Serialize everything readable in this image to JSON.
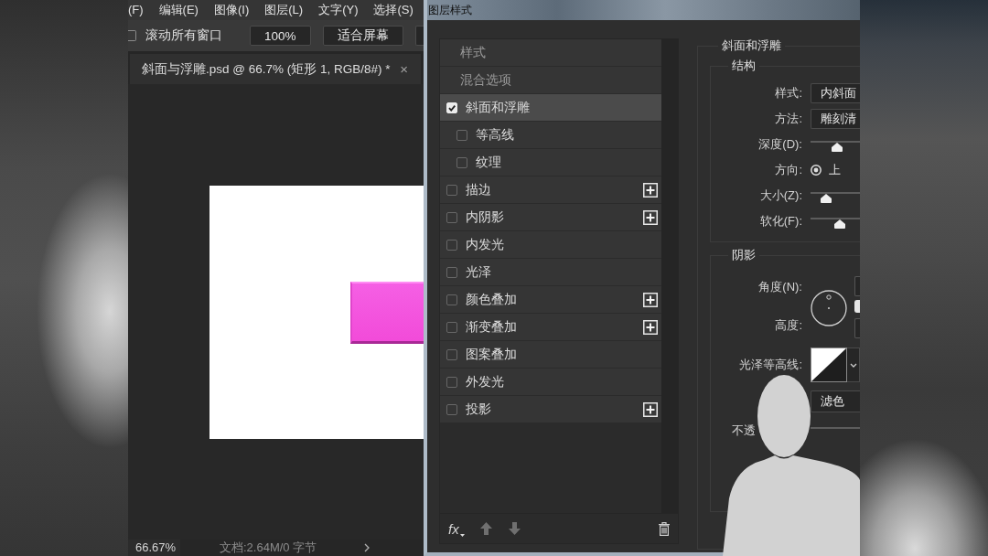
{
  "workspace": {
    "menu_bar": [
      "(F)",
      "编辑(E)",
      "图像(I)",
      "图层(L)",
      "文字(Y)",
      "选择(S)"
    ],
    "options_bar": {
      "scroll_all_windows": {
        "label": "滚动所有窗口",
        "checked": false
      },
      "buttons": [
        "100%",
        "适合屏幕"
      ]
    },
    "document_tab": {
      "title": "斜面与浮雕.psd @ 66.7% (矩形 1, RGB/8#) *",
      "close": "×"
    },
    "status_bar": {
      "zoom": "66.67%",
      "document_info": "文档:2.64M/0 字节"
    }
  },
  "dialog": {
    "title": "图层样式",
    "style_list": [
      {
        "kind": "header",
        "label": "样式",
        "selected": false
      },
      {
        "kind": "header",
        "label": "混合选项",
        "selected": false
      },
      {
        "kind": "effect",
        "label": "斜面和浮雕",
        "checked": true,
        "selected": true,
        "addable": false,
        "children": [
          {
            "kind": "effect",
            "label": "等高线",
            "checked": false,
            "selected": false,
            "addable": false
          },
          {
            "kind": "effect",
            "label": "纹理",
            "checked": false,
            "selected": false,
            "addable": false
          }
        ]
      },
      {
        "kind": "effect",
        "label": "描边",
        "checked": false,
        "selected": false,
        "addable": true
      },
      {
        "kind": "effect",
        "label": "内阴影",
        "checked": false,
        "selected": false,
        "addable": true
      },
      {
        "kind": "effect",
        "label": "内发光",
        "checked": false,
        "selected": false,
        "addable": false
      },
      {
        "kind": "effect",
        "label": "光泽",
        "checked": false,
        "selected": false,
        "addable": false
      },
      {
        "kind": "effect",
        "label": "颜色叠加",
        "checked": false,
        "selected": false,
        "addable": true
      },
      {
        "kind": "effect",
        "label": "渐变叠加",
        "checked": false,
        "selected": false,
        "addable": true
      },
      {
        "kind": "effect",
        "label": "图案叠加",
        "checked": false,
        "selected": false,
        "addable": false
      },
      {
        "kind": "effect",
        "label": "外发光",
        "checked": false,
        "selected": false,
        "addable": false
      },
      {
        "kind": "effect",
        "label": "投影",
        "checked": false,
        "selected": false,
        "addable": true
      }
    ],
    "toolbar": {
      "fx": "fx",
      "move_up": {
        "disabled": true
      },
      "move_down": {
        "disabled": true
      },
      "delete": {
        "disabled": false
      }
    },
    "settings": {
      "title": "斜面和浮雕",
      "structure": {
        "legend": "结构",
        "rows": [
          {
            "kind": "dropdown",
            "label": "样式:",
            "value": "内斜面"
          },
          {
            "kind": "dropdown",
            "label": "方法:",
            "value": "雕刻清"
          },
          {
            "kind": "slider",
            "label": "深度(D):",
            "level": 0.53
          },
          {
            "kind": "radio",
            "label": "方向:",
            "options": [
              {
                "label": "上",
                "selected": true
              }
            ]
          },
          {
            "kind": "slider",
            "label": "大小(Z):",
            "level": 0.31
          },
          {
            "kind": "slider",
            "label": "软化(F):",
            "level": 0.59
          }
        ]
      },
      "shading": {
        "legend": "阴影",
        "rows": [
          {
            "kind": "angle",
            "label": "角度(N):",
            "global_light": {
              "checked": true
            }
          },
          {
            "kind": "altitude",
            "label": "高度:"
          },
          {
            "kind": "contour",
            "label": "光泽等高线:"
          },
          {
            "kind": "dropdown",
            "value": "滤色"
          },
          {
            "kind": "slider",
            "label": "不透"
          }
        ]
      }
    }
  }
}
